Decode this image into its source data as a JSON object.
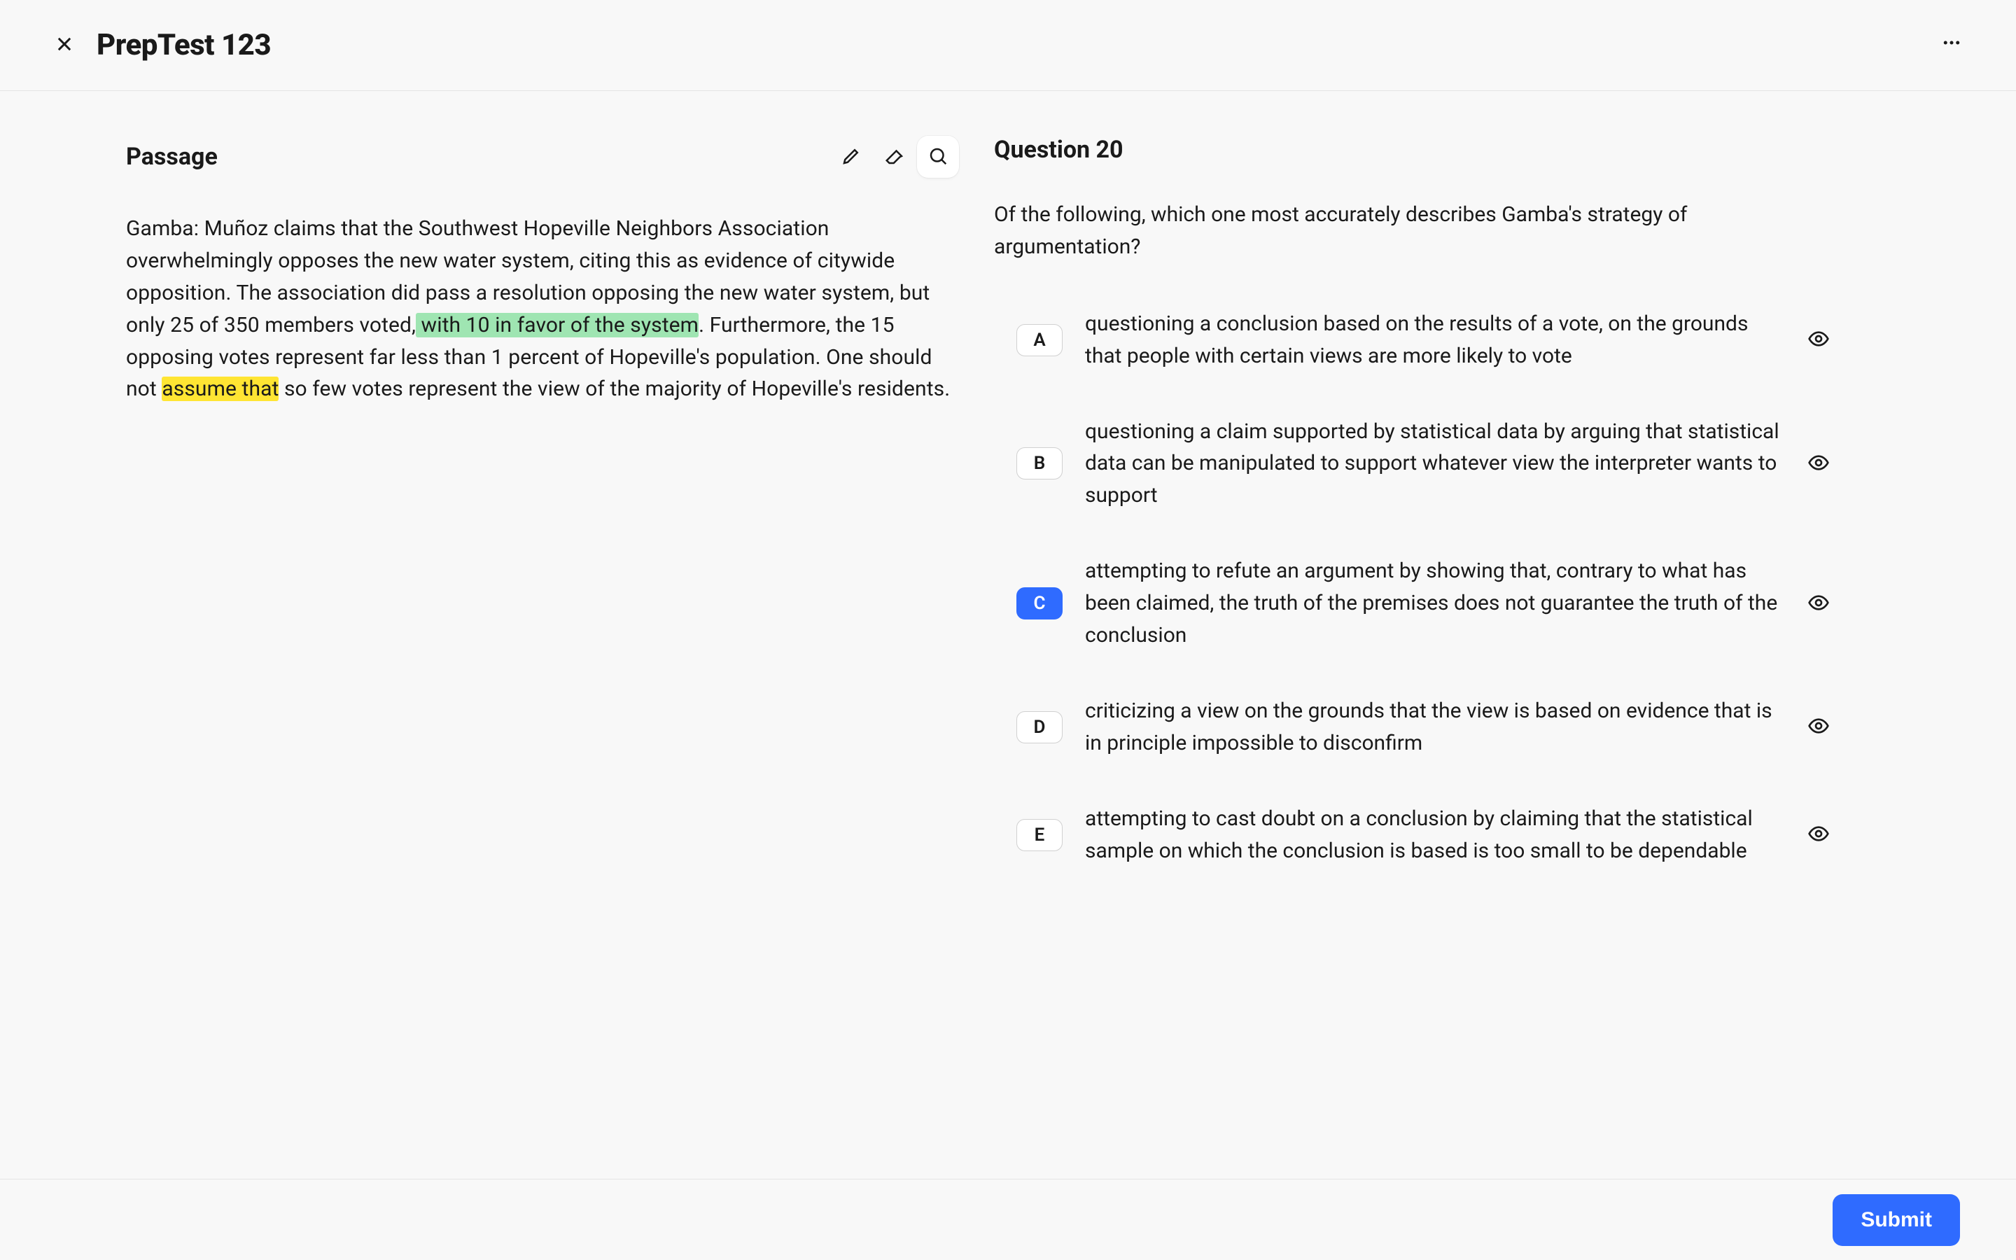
{
  "header": {
    "title": "PrepTest 123"
  },
  "passage": {
    "heading": "Passage",
    "segments": [
      {
        "text": "Gamba: ",
        "indent": false
      },
      {
        "text": "Muñoz claims that the Southwest Hopeville Neighbors Association overwhelmingly opposes the new water system, citing this as evidence of citywide opposition. The association did pass a resolution opposing the new water system, but only 25 of 350 members voted,"
      },
      {
        "text": " with 10 in favor of the system",
        "highlight": "green"
      },
      {
        "text": ". Furthermore, the 15 opposing votes represent far less than 1 percent of Hopeville's population. One should not "
      },
      {
        "text": "assume that",
        "highlight": "yellow"
      },
      {
        "text": " so few votes represent the view of the majority of Hopeville's residents."
      }
    ]
  },
  "question": {
    "heading": "Question 20",
    "prompt": "Of the following, which one most accurately describes Gamba's strategy of argumentation?",
    "selected": "C",
    "choices": [
      {
        "letter": "A",
        "text": "questioning a conclusion based on the results of a vote, on the grounds that people with certain views are more likely to vote"
      },
      {
        "letter": "B",
        "text": "questioning a claim supported by statistical data by arguing that statistical data can be manipulated to support whatever view the interpreter wants to support"
      },
      {
        "letter": "C",
        "text": "attempting to refute an argument by showing that, contrary to what has been claimed, the truth of the premises does not guarantee the truth of the conclusion"
      },
      {
        "letter": "D",
        "text": "criticizing a view on the grounds that the view is based on evidence that is in principle impossible to disconfirm"
      },
      {
        "letter": "E",
        "text": "attempting to cast doubt on a conclusion by claiming that the statistical sample on which the conclusion is based is too small to be dependable"
      }
    ]
  },
  "footer": {
    "submit_label": "Submit"
  }
}
